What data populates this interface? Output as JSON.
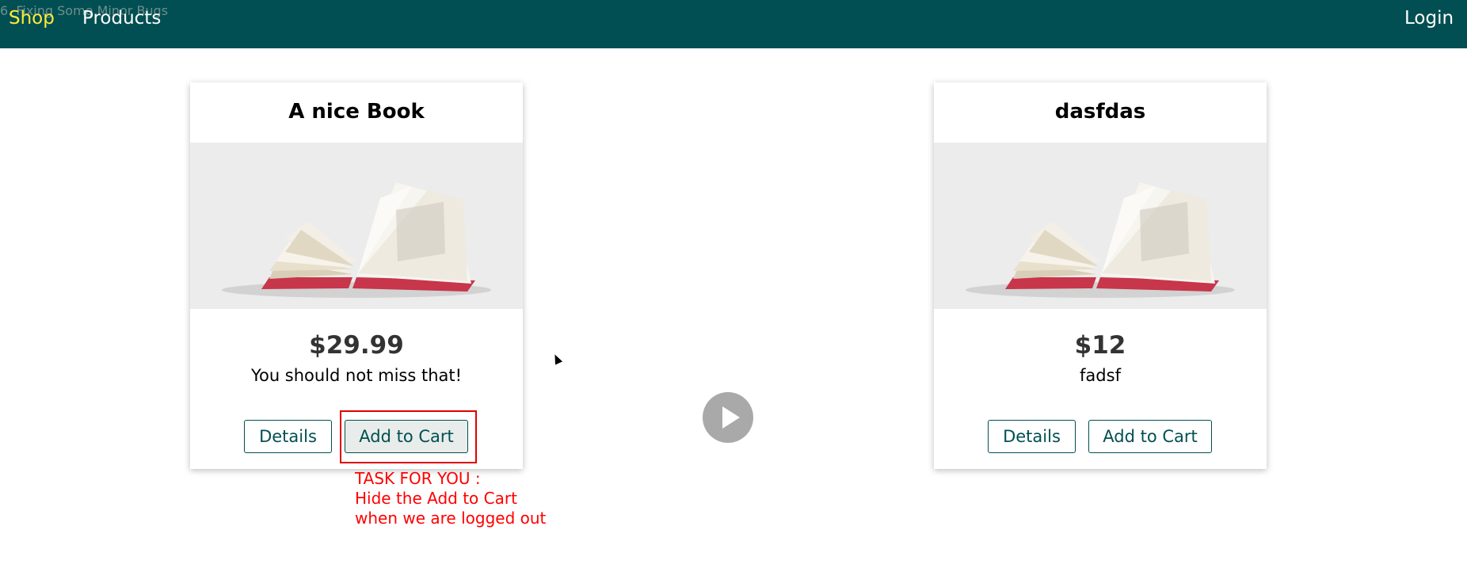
{
  "overlay": {
    "video_title": "6. Fixing Some Minor Bugs",
    "task_note": "TASK FOR YOU :\nHide the Add to Cart\nwhen we are logged out"
  },
  "nav": {
    "shop": "Shop",
    "products": "Products",
    "login": "Login"
  },
  "products": [
    {
      "title": "A nice Book",
      "image_icon": "open-book-image",
      "price": "$29.99",
      "description": "You should not miss that!",
      "details_label": "Details",
      "cart_label": "Add to Cart"
    },
    {
      "title": "dasfdas",
      "image_icon": "open-book-image",
      "price": "$12",
      "description": "fadsf",
      "details_label": "Details",
      "cart_label": "Add to Cart"
    }
  ],
  "colors": {
    "navbar": "#014f52",
    "active_nav": "#ffeb3b",
    "accent": "#014f52",
    "annotation": "#ff0000"
  }
}
